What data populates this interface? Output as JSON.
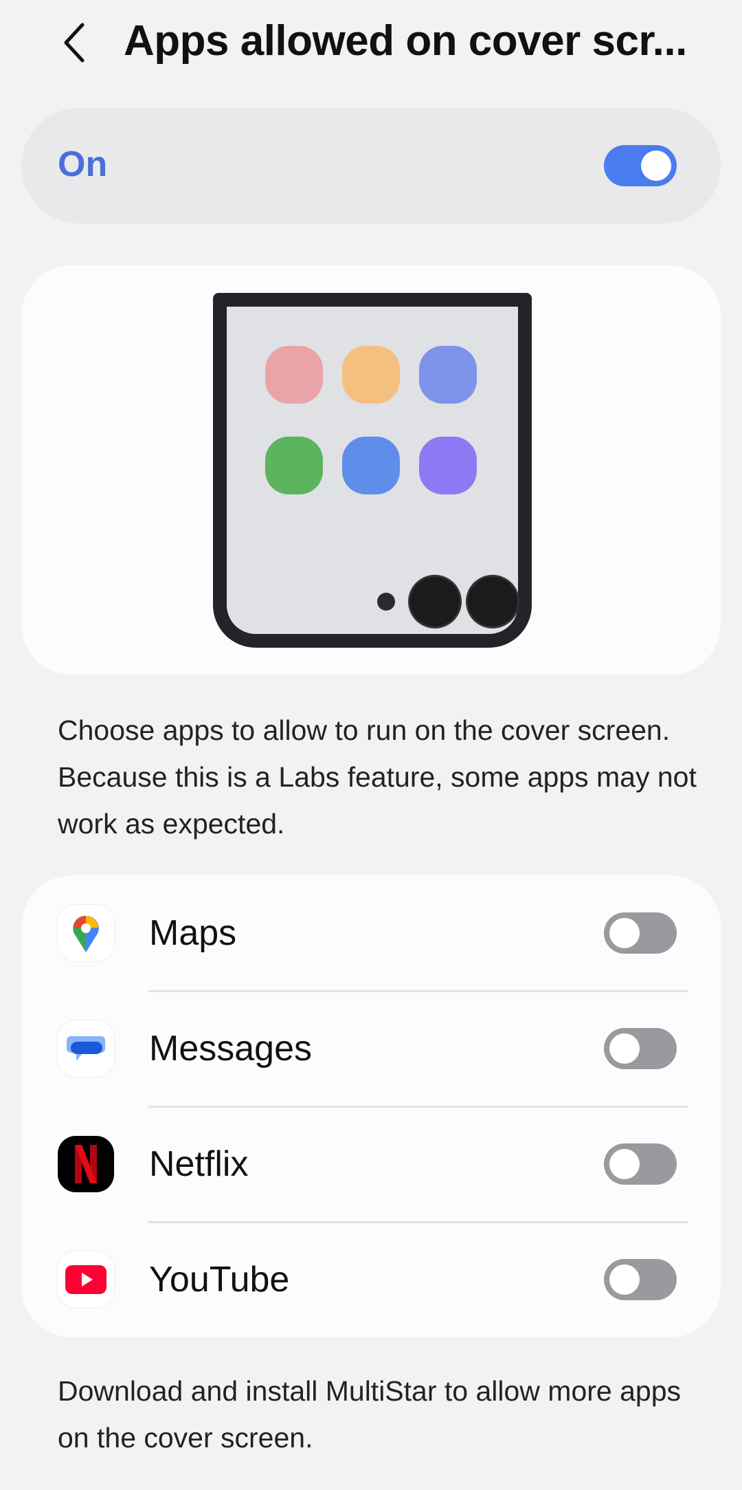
{
  "header": {
    "title": "Apps allowed on cover scr...",
    "back_icon": "chevron-left-icon"
  },
  "master": {
    "label": "On",
    "enabled": true,
    "accent": "#4b6fd6"
  },
  "illustration": {
    "app_colors": [
      "#eaa3a6",
      "#f4c07f",
      "#7e93ea",
      "#5cb55d",
      "#5e8eea",
      "#8e79f5"
    ]
  },
  "description": "Choose apps to allow to run on the cover screen. Because this is a Labs feature, some apps may not work as expected.",
  "apps": [
    {
      "name": "Maps",
      "icon": "google-maps-icon",
      "enabled": false
    },
    {
      "name": "Messages",
      "icon": "google-messages-icon",
      "enabled": false
    },
    {
      "name": "Netflix",
      "icon": "netflix-icon",
      "enabled": false
    },
    {
      "name": "YouTube",
      "icon": "youtube-icon",
      "enabled": false
    }
  ],
  "footer": "Download and install MultiStar to allow more apps on the cover screen."
}
